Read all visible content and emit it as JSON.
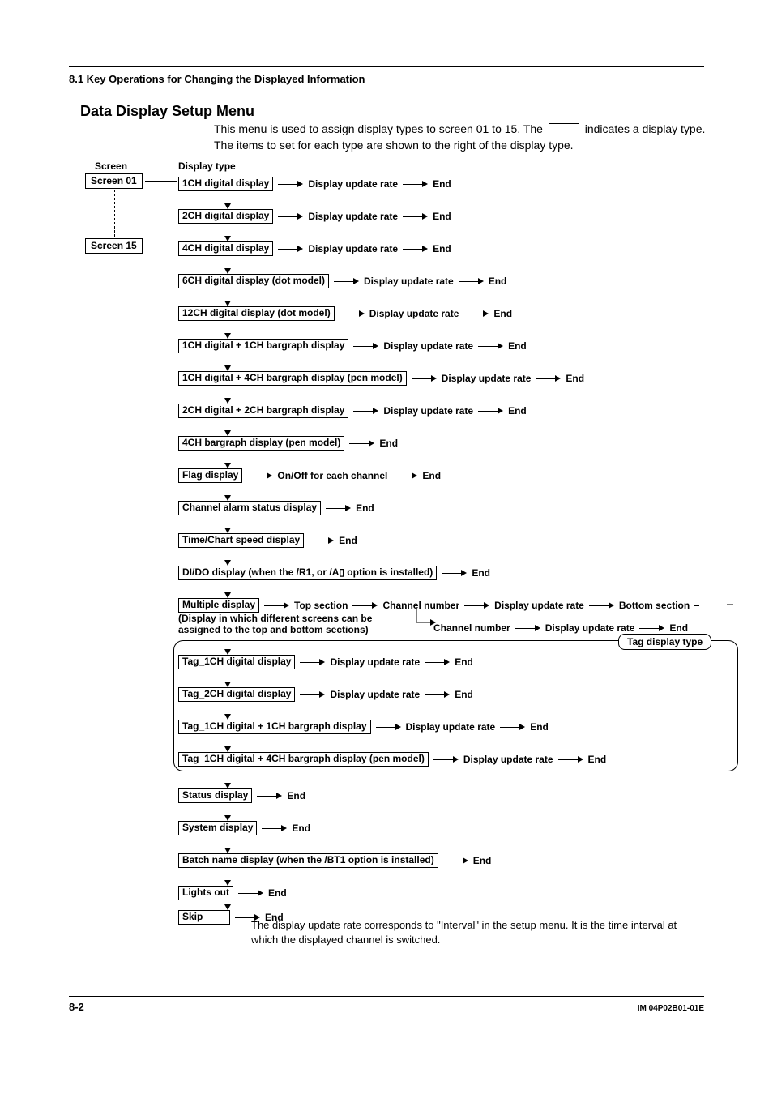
{
  "header": {
    "section": "8.1  Key Operations for Changing the Displayed Information",
    "title": "Data Display Setup Menu",
    "intro_pre": "This menu is used to assign display types to screen 01 to 15. The ",
    "intro_post": " indicates a display type. The items to set for each type are shown to the right of the display type."
  },
  "labels": {
    "screen": "Screen",
    "display_type": "Display type",
    "update": "Display update rate",
    "end": "End",
    "onoff": "On/Off for each channel",
    "top": "Top section",
    "bottom": "Bottom section",
    "chnum": "Channel number",
    "multi_note1": "(Display in which different screens can be",
    "multi_note2": "assigned to the top and bottom sections)",
    "tag_group": "Tag display type"
  },
  "screens": {
    "first": "Screen 01",
    "last": "Screen 15"
  },
  "types": [
    {
      "box": "1CH digital display",
      "flow": [
        "update",
        "end"
      ]
    },
    {
      "box": "2CH digital display",
      "flow": [
        "update",
        "end"
      ]
    },
    {
      "box": "4CH digital display",
      "flow": [
        "update",
        "end"
      ]
    },
    {
      "box": "6CH digital display (dot model)",
      "flow": [
        "update",
        "end"
      ]
    },
    {
      "box": "12CH digital display (dot model)",
      "flow": [
        "update",
        "end"
      ]
    },
    {
      "box": "1CH digital + 1CH bargraph display",
      "flow": [
        "update",
        "end"
      ]
    },
    {
      "box": "1CH digital + 4CH bargraph display (pen model)",
      "flow": [
        "update",
        "end"
      ]
    },
    {
      "box": "2CH digital + 2CH bargraph display",
      "flow": [
        "update",
        "end"
      ]
    },
    {
      "box": "4CH bargraph display (pen model)",
      "flow": [
        "end"
      ]
    },
    {
      "box": "Flag display",
      "flow": [
        "onoff",
        "end"
      ]
    },
    {
      "box": "Channel alarm status display",
      "flow": [
        "end"
      ]
    },
    {
      "box": "Time/Chart speed display",
      "flow": [
        "end"
      ]
    },
    {
      "box": "DI/DO display (when the /R1, or /A▯ option is installed)",
      "flow": [
        "end"
      ]
    },
    {
      "box": "Multiple display",
      "flow": [
        "top",
        "chnum",
        "update",
        "bottom"
      ],
      "multi": true
    },
    {
      "box": "Tag_1CH digital display",
      "flow": [
        "update",
        "end"
      ],
      "tag": true
    },
    {
      "box": "Tag_2CH digital display",
      "flow": [
        "update",
        "end"
      ],
      "tag": true
    },
    {
      "box": "Tag_1CH digital + 1CH bargraph display",
      "flow": [
        "update",
        "end"
      ],
      "tag": true
    },
    {
      "box": "Tag_1CH digital + 4CH bargraph display (pen model)",
      "flow": [
        "update",
        "end"
      ],
      "tag": true
    },
    {
      "box": "Status display",
      "flow": [
        "end"
      ]
    },
    {
      "box": "System display",
      "flow": [
        "end"
      ]
    },
    {
      "box": "Batch name display (when the /BT1 option is installed)",
      "flow": [
        "end"
      ]
    },
    {
      "box": "Lights out",
      "flow": [
        "end"
      ]
    },
    {
      "box": "Skip",
      "flow": [
        "end"
      ],
      "skip": true
    }
  ],
  "multi_second": [
    "chnum",
    "update",
    "end"
  ],
  "row_spacing": {
    "0": 20,
    "1": 60,
    "2": 100,
    "3": 140,
    "4": 180,
    "5": 220,
    "6": 260,
    "7": 300,
    "8": 340,
    "9": 380,
    "10": 420,
    "11": 460,
    "12": 500,
    "13": 540,
    "14": 610,
    "15": 650,
    "16": 690,
    "17": 730,
    "18": 775,
    "19": 815,
    "20": 855,
    "21": 895,
    "22": 925
  },
  "footnote": "The display update rate corresponds to \"Interval\" in the setup menu. It is the time interval at which the displayed channel is switched.",
  "footer": {
    "page": "8-2",
    "doc": "IM 04P02B01-01E"
  }
}
